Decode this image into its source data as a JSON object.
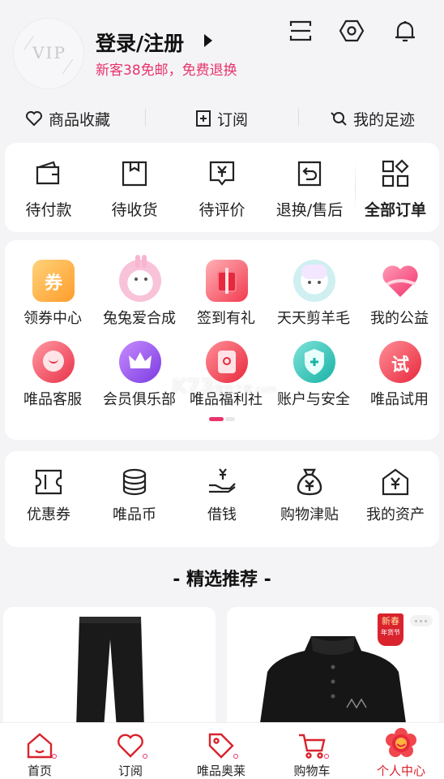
{
  "header": {
    "avatar_text": "VIP",
    "login_label": "登录/注册",
    "promo_text": "新客38免邮，免费退换",
    "icons": [
      "scan-icon",
      "settings-hexagon-icon",
      "bell-icon"
    ]
  },
  "quick_links": [
    {
      "label": "商品收藏",
      "icon": "heart-outline-icon"
    },
    {
      "label": "订阅",
      "icon": "subscribe-plus-icon"
    },
    {
      "label": "我的足迹",
      "icon": "footprint-search-icon"
    }
  ],
  "orders": [
    {
      "label": "待付款",
      "icon": "wallet-icon"
    },
    {
      "label": "待收货",
      "icon": "box-icon"
    },
    {
      "label": "待评价",
      "icon": "review-yen-icon"
    },
    {
      "label": "退换/售后",
      "icon": "return-icon"
    },
    {
      "label": "全部订单",
      "icon": "grid-diamond-icon"
    }
  ],
  "services": [
    {
      "label": "领券中心",
      "icon": "coupon-ticket-icon",
      "badge": "券"
    },
    {
      "label": "兔兔爱合成",
      "icon": "rabbit-icon"
    },
    {
      "label": "签到有礼",
      "icon": "gift-box-icon"
    },
    {
      "label": "天天剪羊毛",
      "icon": "sheep-icon"
    },
    {
      "label": "我的公益",
      "icon": "heart-charity-icon"
    },
    {
      "label": "唯品客服",
      "icon": "customer-service-icon"
    },
    {
      "label": "会员俱乐部",
      "icon": "crown-icon"
    },
    {
      "label": "唯品福利社",
      "icon": "red-envelope-icon"
    },
    {
      "label": "账户与安全",
      "icon": "shield-icon"
    },
    {
      "label": "唯品试用",
      "icon": "trial-icon",
      "badge": "试"
    }
  ],
  "finance": [
    {
      "label": "优惠券",
      "icon": "ticket-icon"
    },
    {
      "label": "唯品币",
      "icon": "coin-stack-icon"
    },
    {
      "label": "借钱",
      "icon": "hand-yen-icon"
    },
    {
      "label": "购物津贴",
      "icon": "money-bag-icon"
    },
    {
      "label": "我的资产",
      "icon": "house-yen-icon"
    }
  ],
  "recommend_title": "- 精选推荐 -",
  "product_badge": {
    "line1": "新春",
    "line2": "年货节"
  },
  "watermark": {
    "big": "K73",
    "small": "游戏之家",
    "domain": ".com"
  },
  "tabs": [
    {
      "label": "首页",
      "icon": "home-icon",
      "active": false
    },
    {
      "label": "订阅",
      "icon": "heart-tab-icon",
      "active": false
    },
    {
      "label": "唯品奥莱",
      "icon": "tag-icon",
      "active": false
    },
    {
      "label": "购物车",
      "icon": "cart-icon",
      "active": false
    },
    {
      "label": "个人中心",
      "icon": "profile-flower-icon",
      "active": true
    }
  ],
  "colors": {
    "accent": "#e8336b",
    "brand_red": "#d9232d"
  }
}
